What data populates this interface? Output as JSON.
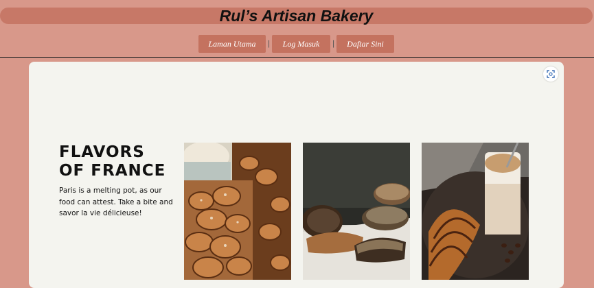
{
  "header": {
    "title": "Rul’s Artisan Bakery"
  },
  "nav": {
    "items": [
      {
        "label": "Laman Utama"
      },
      {
        "label": "Log Masuk"
      },
      {
        "label": "Daftar Sini"
      }
    ],
    "separator": "|"
  },
  "hero": {
    "heading_line1": "FLAVORS",
    "heading_line2": "OF FRANCE",
    "description": "Paris is a melting pot, as our food can attest. Take a bite and savor la vie délicieuse!"
  },
  "gallery": {
    "images": [
      {
        "icon": "pastries-tray-image"
      },
      {
        "icon": "sourdough-bread-image"
      },
      {
        "icon": "croissant-latte-image"
      }
    ]
  },
  "colors": {
    "page_background": "#d8988a",
    "title_bar": "#c77867",
    "nav_button": "#c4725f",
    "panel": "#f4f4ef"
  }
}
